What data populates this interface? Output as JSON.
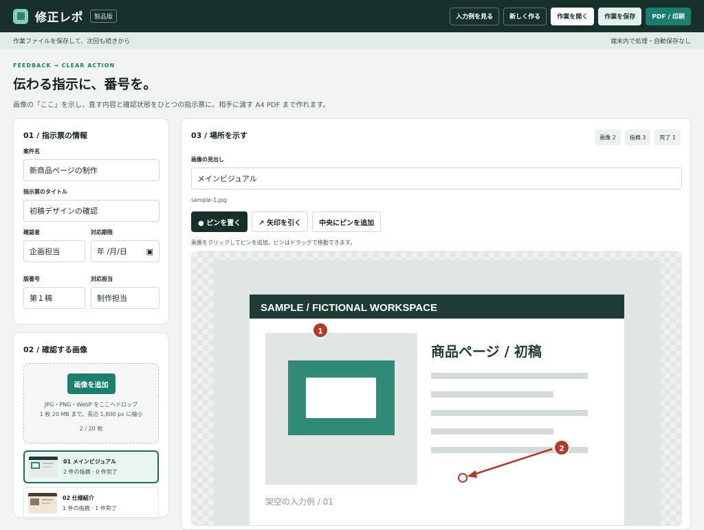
{
  "app": {
    "title": "修正レポ",
    "badge": "製品版"
  },
  "toolbar": {
    "examples": "入力例を見る",
    "new": "新しく作る",
    "open": "作業を開く",
    "save": "作業を保存",
    "pdf": "PDF / 印刷"
  },
  "subbar": {
    "left": "作業ファイルを保存して、次回も続きから",
    "right": "端末内で処理・自動保存なし"
  },
  "hero": {
    "eyebrow": "FEEDBACK → CLEAR ACTION",
    "title": "伝わる指示に、番号を。",
    "desc": "画像の「ここ」を示し、直す内容と確認状態をひとつの指示票に。相手に渡す A4 PDF まで作れます。"
  },
  "info": {
    "heading": "01 / 指示票の情報",
    "project_label": "案件名",
    "project_value": "新商品ページの制作",
    "title_label": "指示票のタイトル",
    "title_value": "初稿デザインの確認",
    "reviewer_label": "確認者",
    "reviewer_value": "企画担当",
    "due_label": "対応期限",
    "due_value": "年 /月/日",
    "version_label": "版番号",
    "version_value": "第１稿",
    "assignee_label": "対応担当",
    "assignee_value": "制作担当"
  },
  "images": {
    "heading": "02 / 確認する画像",
    "add_label": "画像を追加",
    "drop_line1": "JPG・PNG・WebP をここへドロップ",
    "drop_line2": "1 枚 20 MB まで。長辺 1,800 px に縮小",
    "count": "2 / 20 枚",
    "items": [
      {
        "title": "01 メインビジュアル",
        "sub": "2 件の指摘 · 0 件完了"
      },
      {
        "title": "02 仕様紹介",
        "sub": "1 件の指摘 · 1 件完了"
      }
    ]
  },
  "mark": {
    "heading": "03 / 場所を示す",
    "pills": [
      "画像 2",
      "指摘 3",
      "完了 1"
    ],
    "caption_label": "画像の見出し",
    "caption_value": "メインビジュアル",
    "filename": "sample-1.jpg",
    "tools": {
      "pin": "● ピンを置く",
      "arrow": "↗ 矢印を引く",
      "center": "中央にピンを追加"
    },
    "hint": "画像をクリックしてピンを追加。ピンはドラッグで移動できます。"
  },
  "sample": {
    "header": "SAMPLE / FICTIONAL WORKSPACE",
    "headline": "商品ページ / 初稿",
    "footer": "架空の入力例 / 01",
    "pin1": "1",
    "pin2": "2"
  },
  "colors": {
    "dark": "#17302c",
    "teal": "#19806d",
    "pin": "#b23a2a",
    "frame": "#2f8b76"
  }
}
